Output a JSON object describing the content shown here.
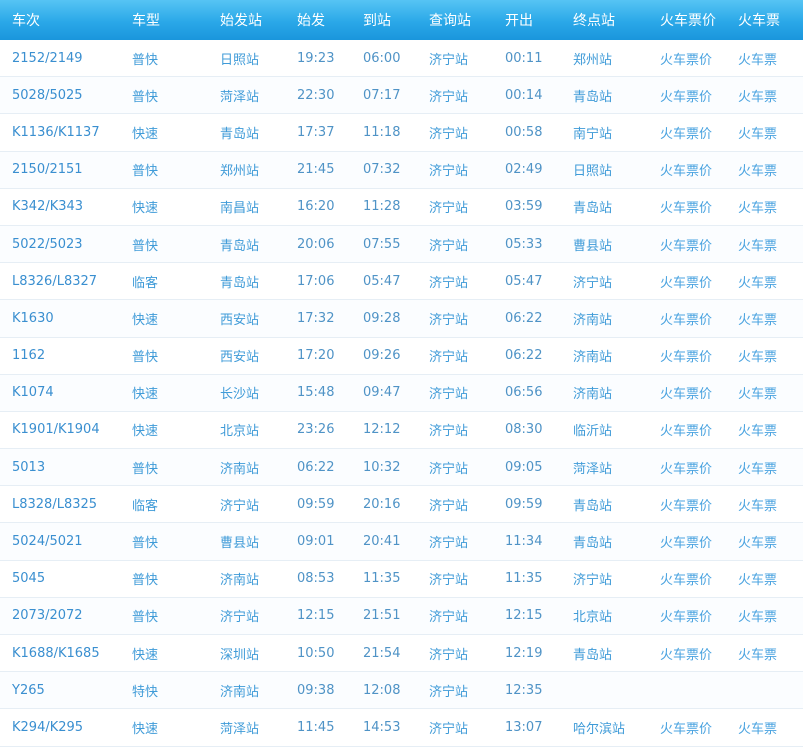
{
  "table": {
    "headers": [
      "车次",
      "车型",
      "始发站",
      "始发",
      "到站",
      "查询站",
      "开出",
      "终点站",
      "火车票价",
      "火车票"
    ],
    "rows": [
      [
        "2152/2149",
        "普快",
        "日照站",
        "19:23",
        "06:00",
        "济宁站",
        "00:11",
        "郑州站",
        "火车票价",
        "火车票"
      ],
      [
        "5028/5025",
        "普快",
        "菏泽站",
        "22:30",
        "07:17",
        "济宁站",
        "00:14",
        "青岛站",
        "火车票价",
        "火车票"
      ],
      [
        "K1136/K1137",
        "快速",
        "青岛站",
        "17:37",
        "11:18",
        "济宁站",
        "00:58",
        "南宁站",
        "火车票价",
        "火车票"
      ],
      [
        "2150/2151",
        "普快",
        "郑州站",
        "21:45",
        "07:32",
        "济宁站",
        "02:49",
        "日照站",
        "火车票价",
        "火车票"
      ],
      [
        "K342/K343",
        "快速",
        "南昌站",
        "16:20",
        "11:28",
        "济宁站",
        "03:59",
        "青岛站",
        "火车票价",
        "火车票"
      ],
      [
        "5022/5023",
        "普快",
        "青岛站",
        "20:06",
        "07:55",
        "济宁站",
        "05:33",
        "曹县站",
        "火车票价",
        "火车票"
      ],
      [
        "L8326/L8327",
        "临客",
        "青岛站",
        "17:06",
        "05:47",
        "济宁站",
        "05:47",
        "济宁站",
        "火车票价",
        "火车票"
      ],
      [
        "K1630",
        "快速",
        "西安站",
        "17:32",
        "09:28",
        "济宁站",
        "06:22",
        "济南站",
        "火车票价",
        "火车票"
      ],
      [
        "1162",
        "普快",
        "西安站",
        "17:20",
        "09:26",
        "济宁站",
        "06:22",
        "济南站",
        "火车票价",
        "火车票"
      ],
      [
        "K1074",
        "快速",
        "长沙站",
        "15:48",
        "09:47",
        "济宁站",
        "06:56",
        "济南站",
        "火车票价",
        "火车票"
      ],
      [
        "K1901/K1904",
        "快速",
        "北京站",
        "23:26",
        "12:12",
        "济宁站",
        "08:30",
        "临沂站",
        "火车票价",
        "火车票"
      ],
      [
        "5013",
        "普快",
        "济南站",
        "06:22",
        "10:32",
        "济宁站",
        "09:05",
        "菏泽站",
        "火车票价",
        "火车票"
      ],
      [
        "L8328/L8325",
        "临客",
        "济宁站",
        "09:59",
        "20:16",
        "济宁站",
        "09:59",
        "青岛站",
        "火车票价",
        "火车票"
      ],
      [
        "5024/5021",
        "普快",
        "曹县站",
        "09:01",
        "20:41",
        "济宁站",
        "11:34",
        "青岛站",
        "火车票价",
        "火车票"
      ],
      [
        "5045",
        "普快",
        "济南站",
        "08:53",
        "11:35",
        "济宁站",
        "11:35",
        "济宁站",
        "火车票价",
        "火车票"
      ],
      [
        "2073/2072",
        "普快",
        "济宁站",
        "12:15",
        "21:51",
        "济宁站",
        "12:15",
        "北京站",
        "火车票价",
        "火车票"
      ],
      [
        "K1688/K1685",
        "快速",
        "深圳站",
        "10:50",
        "21:54",
        "济宁站",
        "12:19",
        "青岛站",
        "火车票价",
        "火车票"
      ],
      [
        "Y265",
        "特快",
        "济南站",
        "09:38",
        "12:08",
        "济宁站",
        "12:35",
        "",
        "",
        ""
      ],
      [
        "K294/K295",
        "快速",
        "菏泽站",
        "11:45",
        "14:53",
        "济宁站",
        "13:07",
        "哈尔滨站",
        "火车票价",
        "火车票"
      ]
    ]
  },
  "colors": {
    "header_top": "#56c4f4",
    "header_bottom": "#1a96dc",
    "header_text": "#ffffff",
    "cell_text": "#3a8fd0",
    "row_border": "#e6eef5"
  }
}
